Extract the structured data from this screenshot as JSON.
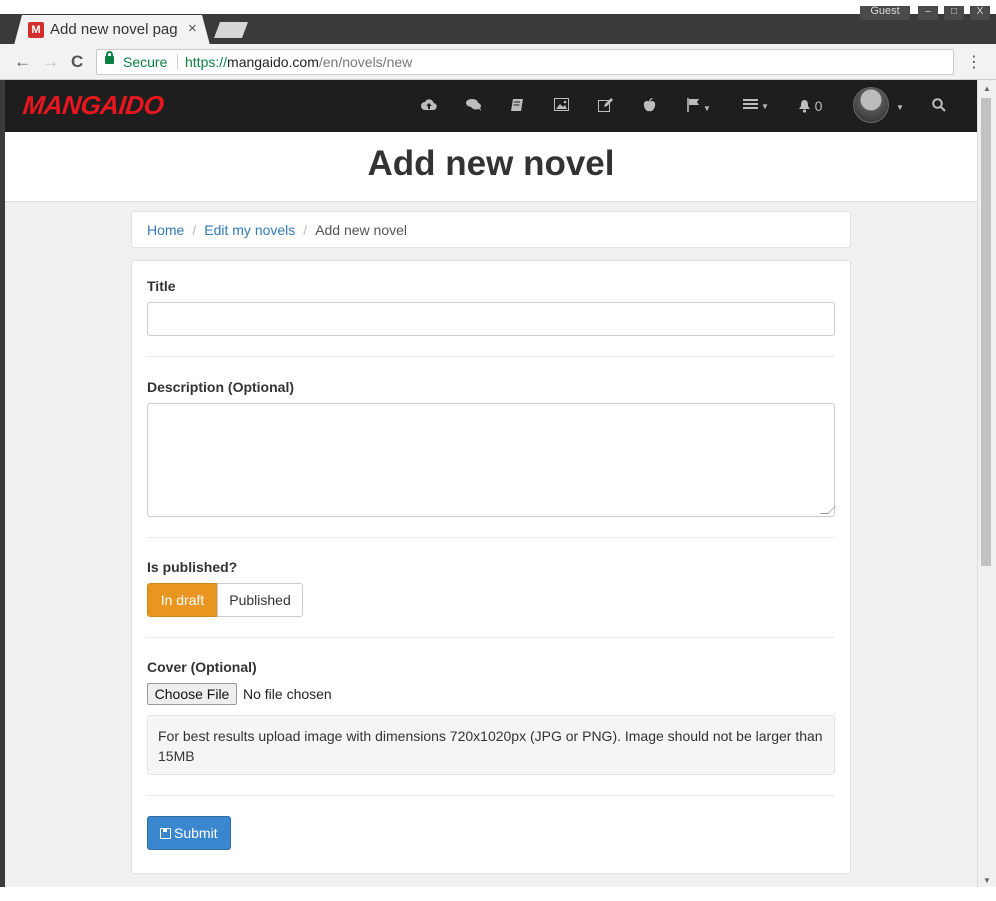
{
  "browser": {
    "tab_title": "Add new novel pag",
    "tab_close": "×",
    "favicon_letter": "M",
    "profile": "Guest",
    "window_buttons": [
      "–",
      "□",
      "X"
    ],
    "nav": {
      "back": "←",
      "forward": "→",
      "reload": "C"
    },
    "secure_label": "Secure",
    "url_scheme": "https://",
    "url_host": "mangaido.com",
    "url_path": "/en/novels/new",
    "menu": "⋮"
  },
  "navbar": {
    "brand": "MANGAIDO",
    "brand_color": "#e8161e",
    "icons": [
      "upload-icon",
      "comments-icon",
      "book-icon",
      "image-icon",
      "edit-icon",
      "apple-icon",
      "flag-icon",
      "menu-icon",
      "bell-icon",
      "search-icon"
    ],
    "notification_count": "0"
  },
  "page": {
    "title": "Add new novel"
  },
  "breadcrumb": {
    "home": "Home",
    "separator": "/",
    "edit": "Edit my novels",
    "current": "Add new novel"
  },
  "form": {
    "title_label": "Title",
    "title_value": "",
    "description_label": "Description (Optional)",
    "description_value": "",
    "published_label": "Is published?",
    "draft_button": "In draft",
    "published_button": "Published",
    "selected_state": "In draft",
    "cover_label": "Cover (Optional)",
    "choose_file": "Choose File",
    "no_file": "No file chosen",
    "help_text": "For best results upload image with dimensions 720x1020px (JPG or PNG). Image should not be larger than 15MB",
    "submit": "Submit"
  },
  "colors": {
    "accent_orange": "#e8961f",
    "primary_blue": "#3a87cf",
    "navbar_bg": "#1e1e1e"
  }
}
